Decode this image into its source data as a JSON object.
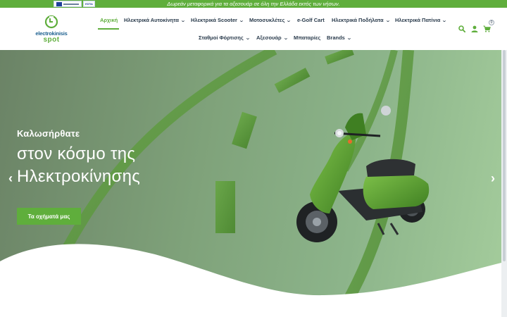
{
  "topbar": {
    "message": "Δωρεάν μεταφορικά για τα αξεσουάρ σε όλη την Ελλάδα εκτός των νήσων.",
    "espa_label": "ΕΣΠΑ"
  },
  "logo": {
    "word": "electrokinisis",
    "spot": "spot"
  },
  "nav": {
    "row1": [
      {
        "label": "Αρχική",
        "active": true,
        "dropdown": false
      },
      {
        "label": "Ηλεκτρικά Αυτοκίνητα",
        "dropdown": true
      },
      {
        "label": "Ηλεκτρικά Scooter",
        "dropdown": true
      },
      {
        "label": "Μοτοσυκλέτες",
        "dropdown": true
      },
      {
        "label": "e-Golf Cart",
        "dropdown": false
      },
      {
        "label": "Ηλεκτρικά Ποδήλατα",
        "dropdown": true
      },
      {
        "label": "Ηλεκτρικά Πατίνια",
        "dropdown": true
      }
    ],
    "row2": [
      {
        "label": "Σταθμοί Φόρτισης",
        "dropdown": true
      },
      {
        "label": "Αξεσουάρ",
        "dropdown": true
      },
      {
        "label": "Μπαταρίες",
        "dropdown": false
      },
      {
        "label": "Brands",
        "dropdown": true
      }
    ],
    "chevron": "⌄"
  },
  "header_icons": {
    "search": "search-icon",
    "account": "user-icon",
    "cart": "cart-icon",
    "cart_count": "0"
  },
  "hero": {
    "greeting": "Καλωσήρθατε",
    "title_line1": "στον κόσμο της",
    "title_line2": "Ηλεκτροκίνησης",
    "button_label": "Τα οχήματά μας",
    "prev_arrow": "‹",
    "next_arrow": "›"
  },
  "colors": {
    "brand_green": "#5fae3c",
    "nav_text": "#2a3b4c",
    "logo_blue": "#1a5e8e"
  }
}
